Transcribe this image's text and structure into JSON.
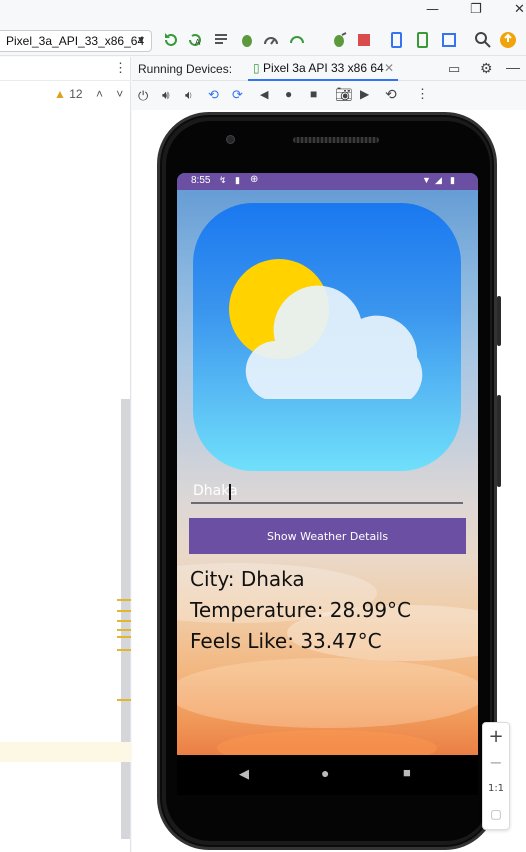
{
  "toolbar": {
    "device_selector": "Pixel_3a_API_33_x86_64"
  },
  "editor": {
    "warning_count": "12"
  },
  "running_devices": {
    "title": "Running Devices:",
    "tab_label": "Pixel 3a API 33 x86 64"
  },
  "emulator": {
    "status_time": "8:55",
    "city_input_value": "Dhaka",
    "show_button_label": "Show Weather Details",
    "city_line": "City: Dhaka",
    "temperature_line": "Temperature: 28.99°C",
    "feels_like_line": "Feels Like: 33.47°C"
  },
  "zoom": {
    "plus": "+",
    "minus": "−",
    "one_to_one": "1:1"
  },
  "colors": {
    "accent_purple": "#6a4fa3",
    "ide_blue": "#3574f0",
    "warning_yellow": "#e2b72c"
  }
}
